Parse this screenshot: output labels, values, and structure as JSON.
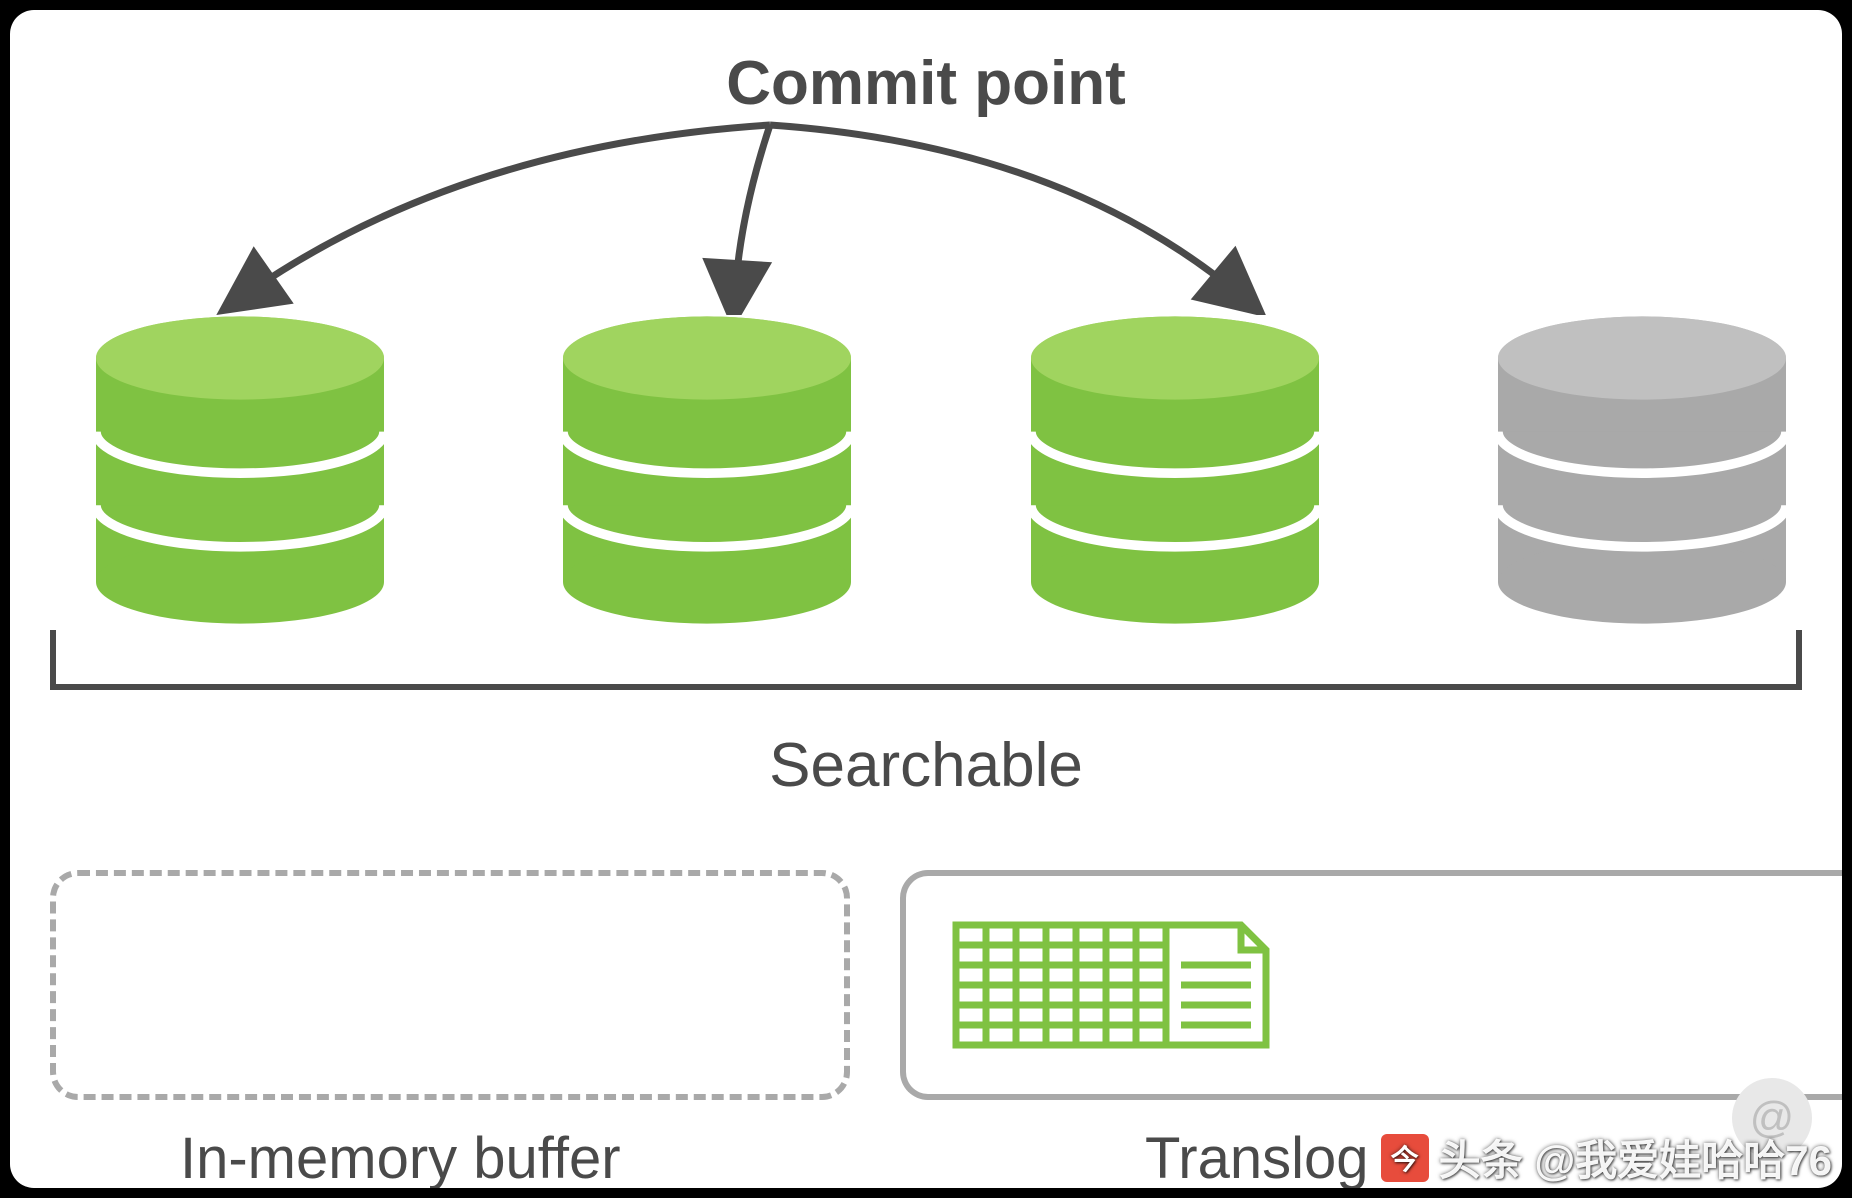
{
  "title": "Commit point",
  "searchable_label": "Searchable",
  "buffer_label": "In-memory buffer",
  "translog_label": "Translog",
  "watermark": "头条 @我爱娃哈哈76",
  "colors": {
    "green_light": "#a0d45f",
    "green_dark": "#7fc242",
    "gray_light": "#c0c0c0",
    "gray_dark": "#a9a9a9",
    "text": "#4a4a4a",
    "doc_green": "#7fc242"
  },
  "databases": [
    {
      "state": "committed"
    },
    {
      "state": "committed"
    },
    {
      "state": "committed"
    },
    {
      "state": "uncommitted"
    }
  ]
}
